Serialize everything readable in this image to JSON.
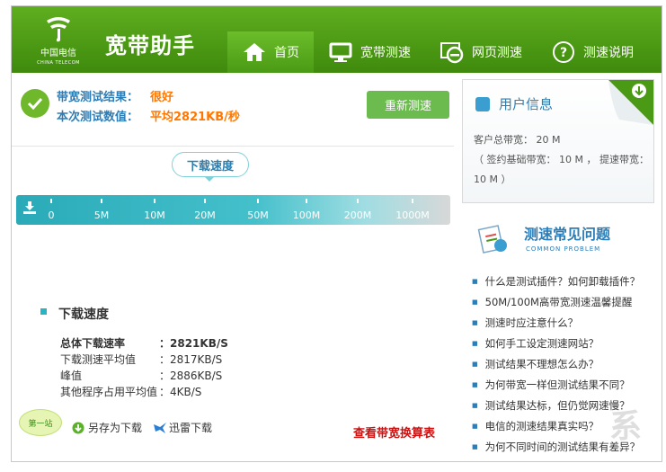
{
  "header": {
    "logo_cn": "中国电信",
    "logo_en": "CHINA TELECOM",
    "app_title": "宽带助手",
    "nav": [
      {
        "label": "首页"
      },
      {
        "label": "宽带测速"
      },
      {
        "label": "网页测速"
      },
      {
        "label": "测速说明"
      }
    ]
  },
  "result": {
    "label_result": "带宽测试结果：",
    "value_result": "很好",
    "label_value": "本次测试数值：",
    "value_value": "平均2821KB/秒",
    "retest_button": "重新测速"
  },
  "speed_meter": {
    "bubble": "下载速度",
    "scale": [
      "0",
      "5M",
      "10M",
      "20M",
      "50M",
      "100M",
      "200M",
      "1000M"
    ]
  },
  "details": {
    "title": "下载速度",
    "stats": [
      {
        "label": "总体下载速率",
        "value": "：2821KB/S",
        "bold": true
      },
      {
        "label": "下载测速平均值",
        "value": "：2817KB/S",
        "bold": false
      },
      {
        "label": "峰值",
        "value": "：2886KB/S",
        "bold": false
      },
      {
        "label": "其他程序占用平均值",
        "value": "：4KB/S",
        "bold": false
      }
    ],
    "badge": "第一站",
    "save_as": "另存为下载",
    "xunlei": "迅雷下载",
    "rate_table": "查看带宽换算表"
  },
  "user_info": {
    "title": "用户信息",
    "line1": "客户总带宽： 20 M",
    "line2": "（ 签约基础带宽： 10 M ， 提速带宽：",
    "line3": "10 M ）"
  },
  "faq": {
    "title": "测速常见问题",
    "subtitle": "COMMON PROBLEM",
    "items": [
      "什么是测试插件？如何卸载插件？",
      "50M/100M高带宽测速温馨提醒",
      "测速时应注意什么？",
      "如何手工设定测速网站？",
      "测试结果不理想怎么办？",
      "为何带宽一样但测试结果不同？",
      "测试结果达标，但仍觉网速慢？",
      "电信的测速结果真实吗？",
      "为何不同时间的测试结果有差异？"
    ]
  },
  "colors": {
    "header_green": "#4a9a15",
    "accent_blue": "#2d7db6",
    "accent_orange": "#ff7700",
    "link_red": "#cc1111",
    "bar_teal": "#2aaab8"
  }
}
